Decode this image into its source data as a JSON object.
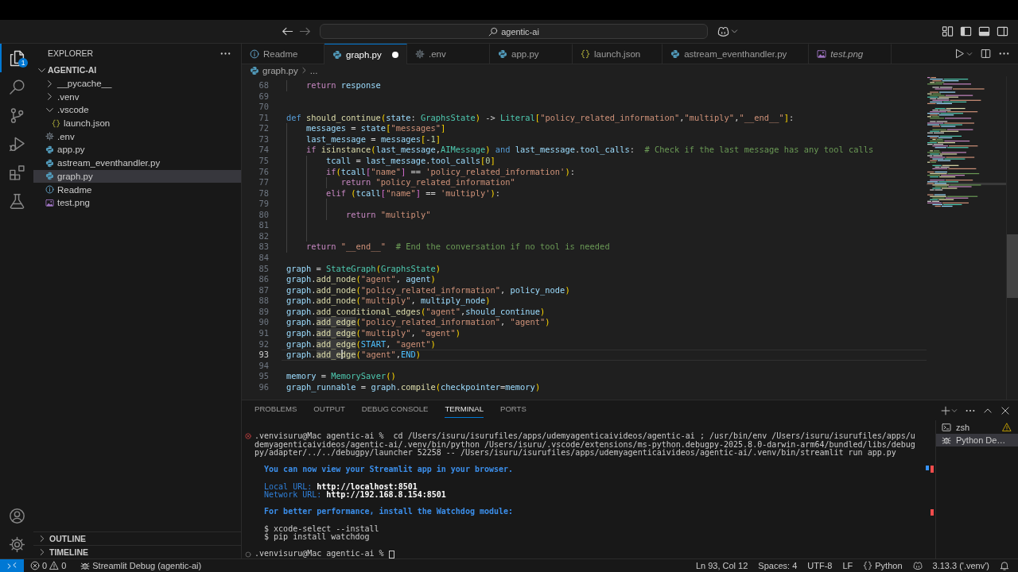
{
  "title_bar": {
    "command_center": "agentic-ai"
  },
  "activity_bar": {
    "items": [
      {
        "kind": "explorer",
        "selected": true,
        "badge": "1"
      },
      {
        "kind": "search",
        "selected": false
      },
      {
        "kind": "source_control",
        "selected": false
      },
      {
        "kind": "run_debug",
        "selected": false
      },
      {
        "kind": "extensions",
        "selected": false
      },
      {
        "kind": "testing",
        "selected": false
      }
    ],
    "bottom_items": [
      {
        "kind": "account"
      },
      {
        "kind": "settings"
      }
    ]
  },
  "sidebar": {
    "title": "EXPLORER",
    "root": {
      "label": "AGENTIC-AI",
      "expanded": true,
      "children": [
        {
          "kind": "folder",
          "label": "__pycache__",
          "expanded": false,
          "selected": false
        },
        {
          "kind": "folder",
          "label": ".venv",
          "expanded": false,
          "selected": false
        },
        {
          "kind": "folder",
          "label": ".vscode",
          "expanded": true,
          "selected": false,
          "children": [
            {
              "kind": "json",
              "label": "launch.json",
              "selected": false
            }
          ]
        },
        {
          "kind": "env",
          "label": ".env",
          "selected": false
        },
        {
          "kind": "python",
          "label": "app.py",
          "selected": false
        },
        {
          "kind": "python",
          "label": "astream_eventhandler.py",
          "selected": false
        },
        {
          "kind": "python",
          "label": "graph.py",
          "selected": true
        },
        {
          "kind": "info",
          "label": "Readme",
          "selected": false
        },
        {
          "kind": "image",
          "label": "test.png",
          "selected": false
        }
      ]
    },
    "sections": [
      {
        "label": "OUTLINE",
        "expanded": false
      },
      {
        "label": "TIMELINE",
        "expanded": false
      }
    ]
  },
  "editor": {
    "tabs": [
      {
        "kind": "info",
        "label": "Readme",
        "selected": false,
        "modified": false,
        "preview": false
      },
      {
        "kind": "python",
        "label": "graph.py",
        "selected": true,
        "modified": true,
        "preview": false
      },
      {
        "kind": "env",
        "label": ".env",
        "selected": false,
        "modified": false,
        "preview": false
      },
      {
        "kind": "python",
        "label": "app.py",
        "selected": false,
        "modified": false,
        "preview": false
      },
      {
        "kind": "json",
        "label": "launch.json",
        "selected": false,
        "modified": false,
        "preview": false
      },
      {
        "kind": "python",
        "label": "astream_eventhandler.py",
        "selected": false,
        "modified": false,
        "preview": false
      },
      {
        "kind": "image",
        "label": "test.png",
        "selected": false,
        "modified": false,
        "preview": true
      }
    ],
    "breadcrumb": [
      {
        "kind": "python",
        "label": "graph.py"
      },
      {
        "kind": "more",
        "label": "..."
      }
    ],
    "lines": [
      {
        "number": "68",
        "current": false,
        "tokens": [
          {
            "kind": "control",
            "text": "    return "
          },
          {
            "kind": "variable",
            "text": "response"
          }
        ]
      },
      {
        "number": "69",
        "current": false
      },
      {
        "number": "70",
        "current": false
      },
      {
        "number": "71",
        "current": false,
        "tokens": [
          {
            "kind": "keyword",
            "text": "def "
          },
          {
            "kind": "function",
            "text": "should_continue"
          },
          {
            "kind": "bracket1",
            "text": "("
          },
          {
            "kind": "variable",
            "text": "state"
          },
          {
            "kind": "operator",
            "text": ": "
          },
          {
            "kind": "class",
            "text": "GraphsState"
          },
          {
            "kind": "bracket1",
            "text": ")"
          },
          {
            "kind": "operator",
            "text": " -> "
          },
          {
            "kind": "class",
            "text": "Literal"
          },
          {
            "kind": "bracket1",
            "text": "["
          },
          {
            "kind": "string",
            "text": "\"policy_related_information\""
          },
          {
            "kind": "operator",
            "text": ","
          },
          {
            "kind": "string",
            "text": "\"multiply\""
          },
          {
            "kind": "operator",
            "text": ","
          },
          {
            "kind": "string",
            "text": "\"__end__\""
          },
          {
            "kind": "bracket1",
            "text": "]"
          },
          {
            "kind": "operator",
            "text": ":"
          }
        ]
      },
      {
        "number": "72",
        "current": false,
        "tokens": [
          {
            "kind": "variable",
            "text": "    messages"
          },
          {
            "kind": "operator",
            "text": " = "
          },
          {
            "kind": "variable",
            "text": "state"
          },
          {
            "kind": "bracket1",
            "text": "["
          },
          {
            "kind": "string",
            "text": "\"messages\""
          },
          {
            "kind": "bracket1",
            "text": "]"
          }
        ]
      },
      {
        "number": "73",
        "current": false,
        "tokens": [
          {
            "kind": "variable",
            "text": "    last_message"
          },
          {
            "kind": "operator",
            "text": " = "
          },
          {
            "kind": "variable",
            "text": "messages"
          },
          {
            "kind": "bracket1",
            "text": "["
          },
          {
            "kind": "operator",
            "text": "-"
          },
          {
            "kind": "number",
            "text": "1"
          },
          {
            "kind": "bracket1",
            "text": "]"
          }
        ]
      },
      {
        "number": "74",
        "current": false,
        "tokens": [
          {
            "kind": "control",
            "text": "    if "
          },
          {
            "kind": "function",
            "text": "isinstance"
          },
          {
            "kind": "bracket1",
            "text": "("
          },
          {
            "kind": "variable",
            "text": "last_message"
          },
          {
            "kind": "operator",
            "text": ","
          },
          {
            "kind": "class",
            "text": "AIMessage"
          },
          {
            "kind": "bracket1",
            "text": ")"
          },
          {
            "kind": "keyword",
            "text": " and "
          },
          {
            "kind": "variable",
            "text": "last_message"
          },
          {
            "kind": "operator",
            "text": "."
          },
          {
            "kind": "variable",
            "text": "tool_calls"
          },
          {
            "kind": "operator",
            "text": ":  "
          },
          {
            "kind": "comment",
            "text": "# Check if the last message has any tool calls"
          }
        ]
      },
      {
        "number": "75",
        "current": false,
        "tokens": [
          {
            "kind": "variable",
            "text": "        tcall"
          },
          {
            "kind": "operator",
            "text": " = "
          },
          {
            "kind": "variable",
            "text": "last_message"
          },
          {
            "kind": "operator",
            "text": "."
          },
          {
            "kind": "variable",
            "text": "tool_calls"
          },
          {
            "kind": "bracket1",
            "text": "["
          },
          {
            "kind": "number",
            "text": "0"
          },
          {
            "kind": "bracket1",
            "text": "]"
          }
        ]
      },
      {
        "number": "76",
        "current": false,
        "tokens": [
          {
            "kind": "control",
            "text": "        if"
          },
          {
            "kind": "bracket1",
            "text": "("
          },
          {
            "kind": "variable",
            "text": "tcall"
          },
          {
            "kind": "bracket2",
            "text": "["
          },
          {
            "kind": "string",
            "text": "\"name\""
          },
          {
            "kind": "bracket2",
            "text": "]"
          },
          {
            "kind": "operator",
            "text": " == "
          },
          {
            "kind": "string",
            "text": "'policy_related_information'"
          },
          {
            "kind": "bracket1",
            "text": ")"
          },
          {
            "kind": "operator",
            "text": ":"
          }
        ]
      },
      {
        "number": "77",
        "current": false,
        "tokens": [
          {
            "kind": "control",
            "text": "           return "
          },
          {
            "kind": "string",
            "text": "\"policy_related_information\""
          }
        ]
      },
      {
        "number": "78",
        "current": false,
        "tokens": [
          {
            "kind": "control",
            "text": "        elif "
          },
          {
            "kind": "bracket1",
            "text": "("
          },
          {
            "kind": "variable",
            "text": "tcall"
          },
          {
            "kind": "bracket2",
            "text": "["
          },
          {
            "kind": "string",
            "text": "\"name\""
          },
          {
            "kind": "bracket2",
            "text": "]"
          },
          {
            "kind": "operator",
            "text": " == "
          },
          {
            "kind": "string",
            "text": "'multiply'"
          },
          {
            "kind": "bracket1",
            "text": ")"
          },
          {
            "kind": "operator",
            "text": ":"
          }
        ]
      },
      {
        "number": "79",
        "current": false
      },
      {
        "number": "80",
        "current": false,
        "tokens": [
          {
            "kind": "control",
            "text": "            return "
          },
          {
            "kind": "string",
            "text": "\"multiply\""
          }
        ]
      },
      {
        "number": "81",
        "current": false
      },
      {
        "number": "82",
        "current": false
      },
      {
        "number": "83",
        "current": false,
        "tokens": [
          {
            "kind": "control",
            "text": "    return "
          },
          {
            "kind": "string",
            "text": "\"__end__\"  "
          },
          {
            "kind": "comment",
            "text": "# End the conversation if no tool is needed"
          }
        ]
      },
      {
        "number": "84",
        "current": false
      },
      {
        "number": "85",
        "current": false,
        "tokens": [
          {
            "kind": "variable",
            "text": "graph"
          },
          {
            "kind": "operator",
            "text": " = "
          },
          {
            "kind": "class",
            "text": "StateGraph"
          },
          {
            "kind": "bracket1",
            "text": "("
          },
          {
            "kind": "class",
            "text": "GraphsState"
          },
          {
            "kind": "bracket1",
            "text": ")"
          }
        ]
      },
      {
        "number": "86",
        "current": false,
        "tokens": [
          {
            "kind": "variable",
            "text": "graph"
          },
          {
            "kind": "operator",
            "text": "."
          },
          {
            "kind": "function",
            "text": "add_node"
          },
          {
            "kind": "bracket1",
            "text": "("
          },
          {
            "kind": "string",
            "text": "\"agent\""
          },
          {
            "kind": "operator",
            "text": ", "
          },
          {
            "kind": "variable",
            "text": "agent"
          },
          {
            "kind": "bracket1",
            "text": ")"
          }
        ]
      },
      {
        "number": "87",
        "current": false,
        "tokens": [
          {
            "kind": "variable",
            "text": "graph"
          },
          {
            "kind": "operator",
            "text": "."
          },
          {
            "kind": "function",
            "text": "add_node"
          },
          {
            "kind": "bracket1",
            "text": "("
          },
          {
            "kind": "string",
            "text": "\"policy_related_information\""
          },
          {
            "kind": "operator",
            "text": ", "
          },
          {
            "kind": "variable",
            "text": "policy_node"
          },
          {
            "kind": "bracket1",
            "text": ")"
          }
        ]
      },
      {
        "number": "88",
        "current": false,
        "tokens": [
          {
            "kind": "variable",
            "text": "graph"
          },
          {
            "kind": "operator",
            "text": "."
          },
          {
            "kind": "function",
            "text": "add_node"
          },
          {
            "kind": "bracket1",
            "text": "("
          },
          {
            "kind": "string",
            "text": "\"multiply\""
          },
          {
            "kind": "operator",
            "text": ", "
          },
          {
            "kind": "variable",
            "text": "multiply_node"
          },
          {
            "kind": "bracket1",
            "text": ")"
          }
        ]
      },
      {
        "number": "89",
        "current": false,
        "tokens": [
          {
            "kind": "variable",
            "text": "graph"
          },
          {
            "kind": "operator",
            "text": "."
          },
          {
            "kind": "function",
            "text": "add_conditional_edges"
          },
          {
            "kind": "bracket1",
            "text": "("
          },
          {
            "kind": "string",
            "text": "\"agent\""
          },
          {
            "kind": "operator",
            "text": ","
          },
          {
            "kind": "variable",
            "text": "should_continue"
          },
          {
            "kind": "bracket1",
            "text": ")"
          }
        ]
      },
      {
        "number": "90",
        "current": false,
        "tokens": [
          {
            "kind": "variable",
            "text": "graph"
          },
          {
            "kind": "operator",
            "text": "."
          },
          {
            "kind": "match",
            "text": "add_edge"
          },
          {
            "kind": "bracket1",
            "text": "("
          },
          {
            "kind": "string",
            "text": "\"policy_related_information\""
          },
          {
            "kind": "operator",
            "text": ", "
          },
          {
            "kind": "string",
            "text": "\"agent\""
          },
          {
            "kind": "bracket1",
            "text": ")"
          }
        ]
      },
      {
        "number": "91",
        "current": false,
        "tokens": [
          {
            "kind": "variable",
            "text": "graph"
          },
          {
            "kind": "operator",
            "text": "."
          },
          {
            "kind": "match",
            "text": "add_edge"
          },
          {
            "kind": "bracket1",
            "text": "("
          },
          {
            "kind": "string",
            "text": "\"multiply\""
          },
          {
            "kind": "operator",
            "text": ", "
          },
          {
            "kind": "string",
            "text": "\"agent\""
          },
          {
            "kind": "bracket1",
            "text": ")"
          }
        ]
      },
      {
        "number": "92",
        "current": false,
        "tokens": [
          {
            "kind": "variable",
            "text": "graph"
          },
          {
            "kind": "operator",
            "text": "."
          },
          {
            "kind": "match",
            "text": "add_edge"
          },
          {
            "kind": "bracket1",
            "text": "("
          },
          {
            "kind": "constant",
            "text": "START"
          },
          {
            "kind": "operator",
            "text": ", "
          },
          {
            "kind": "string",
            "text": "\"agent\""
          },
          {
            "kind": "bracket1",
            "text": ")"
          }
        ]
      },
      {
        "number": "93",
        "current": true,
        "tokens": [
          {
            "kind": "variable",
            "text": "graph"
          },
          {
            "kind": "operator",
            "text": "."
          },
          {
            "kind": "match",
            "text": "add_e"
          },
          {
            "kind": "cursor"
          },
          {
            "kind": "match",
            "text": "dge"
          },
          {
            "kind": "bracket1",
            "text": "("
          },
          {
            "kind": "string",
            "text": "\"agent\""
          },
          {
            "kind": "operator",
            "text": ","
          },
          {
            "kind": "constant",
            "text": "END"
          },
          {
            "kind": "bracket1",
            "text": ")"
          }
        ]
      },
      {
        "number": "94",
        "current": false
      },
      {
        "number": "95",
        "current": false,
        "tokens": [
          {
            "kind": "variable",
            "text": "memory"
          },
          {
            "kind": "operator",
            "text": " = "
          },
          {
            "kind": "class",
            "text": "MemorySaver"
          },
          {
            "kind": "bracket1",
            "text": "()"
          }
        ]
      },
      {
        "number": "96",
        "current": false,
        "tokens": [
          {
            "kind": "variable",
            "text": "graph_runnable"
          },
          {
            "kind": "operator",
            "text": " = "
          },
          {
            "kind": "variable",
            "text": "graph"
          },
          {
            "kind": "operator",
            "text": "."
          },
          {
            "kind": "function",
            "text": "compile"
          },
          {
            "kind": "bracket1",
            "text": "("
          },
          {
            "kind": "variable",
            "text": "checkpointer"
          },
          {
            "kind": "operator",
            "text": "="
          },
          {
            "kind": "variable",
            "text": "memory"
          },
          {
            "kind": "bracket1",
            "text": ")"
          }
        ]
      }
    ]
  },
  "panel": {
    "tabs": [
      {
        "label": "PROBLEMS",
        "selected": false
      },
      {
        "label": "OUTPUT",
        "selected": false
      },
      {
        "label": "DEBUG CONSOLE",
        "selected": false
      },
      {
        "label": "TERMINAL",
        "selected": true
      },
      {
        "label": "PORTS",
        "selected": false
      }
    ],
    "terminal": {
      "blocks": [
        {
          "lines": [
            {
              "kind": "prompt",
              "failed": true,
              "cursor": false,
              "text": ".venvisuru@Mac agentic-ai %  cd /Users/isuru/isurufiles/apps/udemyagenticaivideos/agentic-ai ; /usr/bin/env /Users/isuru/isurufiles/apps/u"
            },
            {
              "kind": "wrap",
              "text": "demyagenticaivideos/agentic-ai/.venv/bin/python /Users/isuru/.vscode/extensions/ms-python.debugpy-2025.8.0-darwin-arm64/bundled/libs/debug"
            },
            {
              "kind": "wrap",
              "text": "py/adapter/../../debugpy/launcher 52258 -- /Users/isuru/isurufiles/apps/udemyagenticaivideos/agentic-ai/.venv/bin/streamlit run app.py"
            }
          ]
        },
        {
          "lines": [
            {
              "kind": "info",
              "text": "You can now view your Streamlit app in your browser."
            }
          ]
        },
        {
          "lines": [
            {
              "kind": "url",
              "label": "Local URL:",
              "value": "http://localhost:8501"
            },
            {
              "kind": "url",
              "label": "Network URL:",
              "value": "http://192.168.8.154:8501"
            }
          ]
        },
        {
          "lines": [
            {
              "kind": "info",
              "text": "For better performance, install the Watchdog module:"
            }
          ]
        },
        {
          "lines": [
            {
              "kind": "code",
              "text": "$ xcode-select --install"
            },
            {
              "kind": "code",
              "text": "$ pip install watchdog"
            }
          ]
        },
        {
          "lines": [
            {
              "kind": "prompt",
              "failed": false,
              "cursor": true,
              "text": ".venvisuru@Mac agentic-ai % "
            }
          ]
        }
      ]
    },
    "sessions": [
      {
        "kind": "shell",
        "label": "zsh",
        "selected": false,
        "warning": true
      },
      {
        "kind": "debug",
        "label": "Python De…",
        "selected": true,
        "warning": false
      }
    ]
  },
  "status_bar": {
    "problems": {
      "errors": "0",
      "warnings": "0"
    },
    "debug_session": "Streamlit Debug (agentic-ai)",
    "items": [
      {
        "kind": "text",
        "label": "Ln 93, Col 12"
      },
      {
        "kind": "text",
        "label": "Spaces: 4"
      },
      {
        "kind": "text",
        "label": "UTF-8"
      },
      {
        "kind": "text",
        "label": "LF"
      },
      {
        "kind": "language",
        "label": "Python"
      },
      {
        "kind": "copilot"
      },
      {
        "kind": "text",
        "label": "3.13.3 ('.venv')"
      },
      {
        "kind": "bell"
      }
    ]
  }
}
